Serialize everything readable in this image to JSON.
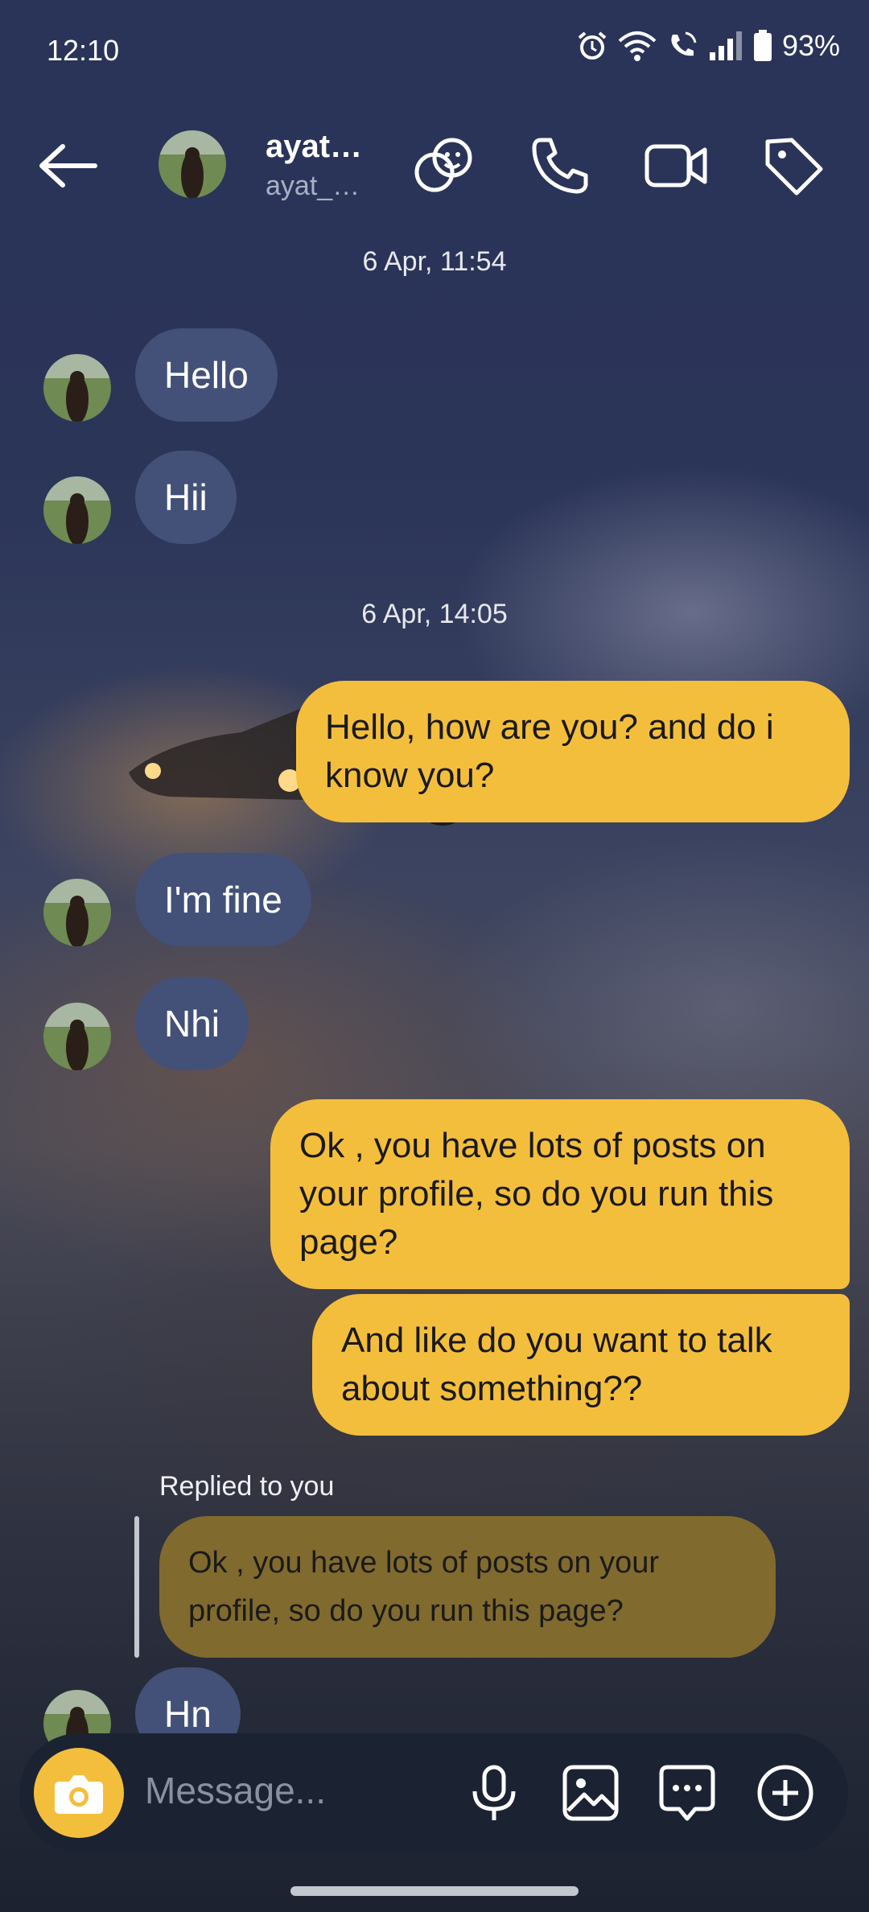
{
  "status_bar": {
    "time": "12:10",
    "battery": "93%",
    "icons": [
      "alarm-icon",
      "wifi-icon",
      "wifi-calling-icon",
      "signal-icon",
      "battery-icon"
    ]
  },
  "header": {
    "name": "ayat…",
    "handle": "ayat_…",
    "icons": [
      "back-arrow-icon",
      "stickers-icon",
      "phone-icon",
      "video-icon",
      "tag-icon"
    ]
  },
  "messages": {
    "stamp_1": "6 Apr, 11:54",
    "m1": "Hello",
    "m2": "Hii",
    "stamp_2": "6 Apr, 14:05",
    "m3_line1": "Hello, how are you?  and do i",
    "m3_line2": "know you?",
    "m4": "I'm fine",
    "m5": "Nhi",
    "m6_line1": "Ok , you have lots of posts on",
    "m6_line2": "your profile, so do you run this",
    "m6_line3": "page?",
    "m7_line1": "And like do you want to talk",
    "m7_line2": "about something??",
    "reply_label": "Replied to you",
    "reply_line1": "Ok , you have lots of posts on your",
    "reply_line2": "profile, so do you run this page?",
    "m8": "Hn"
  },
  "composer": {
    "placeholder": "Message...",
    "icons": [
      "camera-icon",
      "microphone-icon",
      "gallery-icon",
      "chat-bubble-icon",
      "add-icon"
    ]
  },
  "colors": {
    "sent_bubble": "#f4be3d",
    "received_bubble": "#435078",
    "reply_bubble": "#806a2e",
    "composer_bg": "#1b2333"
  }
}
